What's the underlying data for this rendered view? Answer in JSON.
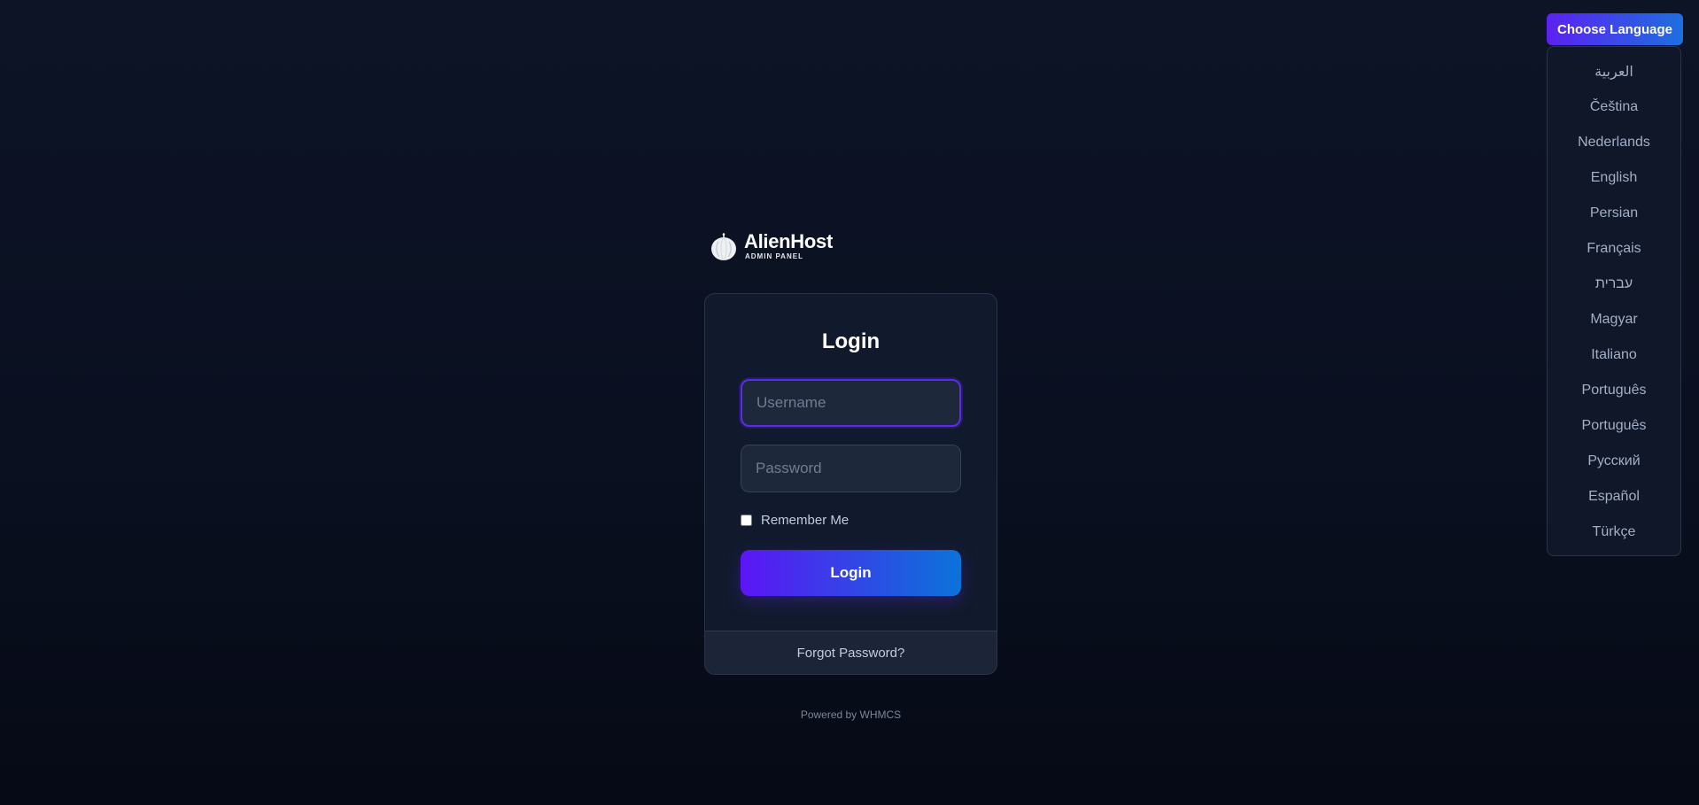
{
  "language": {
    "button_label": "Choose Language",
    "options": [
      "العربية",
      "Čeština",
      "Nederlands",
      "English",
      "Persian",
      "Français",
      "עברית",
      "Magyar",
      "Italiano",
      "Português",
      "Português",
      "Русский",
      "Español",
      "Türkçe"
    ]
  },
  "brand": {
    "name": "AlienHost",
    "subtitle": "ADMIN PANEL",
    "logo_icon": "alien-globe-icon"
  },
  "login": {
    "title": "Login",
    "username_placeholder": "Username",
    "username_value": "",
    "password_placeholder": "Password",
    "password_value": "",
    "remember_label": "Remember Me",
    "remember_checked": false,
    "submit_label": "Login",
    "forgot_label": "Forgot Password?"
  },
  "footer": {
    "powered_by": "Powered by WHMCS"
  },
  "colors": {
    "accent_start": "#5b16f5",
    "accent_end": "#0b73d9",
    "background": "#0a1020",
    "card": "#111a2c"
  }
}
